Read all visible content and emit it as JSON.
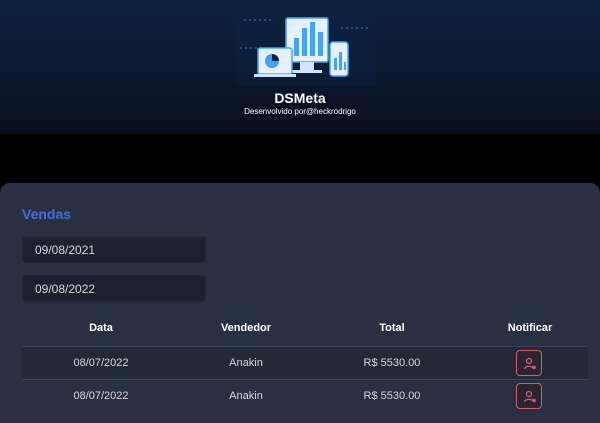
{
  "header": {
    "title": "DSMeta",
    "subtitle": "Desenvolvido por@heckrodrigo",
    "logo_icon": "dashboard-illustration-icon"
  },
  "sales": {
    "title": "Vendas",
    "min_date": "09/08/2021",
    "max_date": "09/08/2022",
    "columns": [
      "Data",
      "Vendedor",
      "Total",
      "Notificar"
    ],
    "rows": [
      {
        "date": "08/07/2022",
        "seller": "Anakin",
        "total": "R$ 5530.00"
      },
      {
        "date": "08/07/2022",
        "seller": "Anakin",
        "total": "R$ 5530.00"
      }
    ],
    "notify_icon": "notification-person-icon"
  },
  "colors": {
    "accent": "#4d6be0",
    "card": "#283142",
    "notify": "#d1606a",
    "header_top": "#0e2240"
  }
}
